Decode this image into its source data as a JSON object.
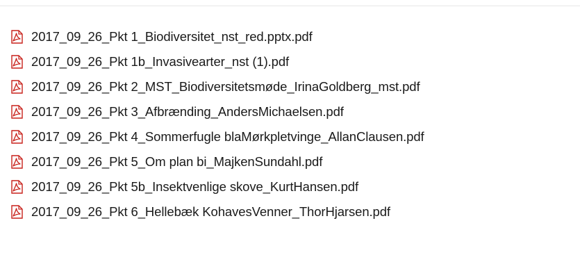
{
  "files": [
    {
      "name": "2017_09_26_Pkt 1_Biodiversitet_nst_red.pptx.pdf",
      "icon": "pdf-file-icon"
    },
    {
      "name": "2017_09_26_Pkt 1b_Invasivearter_nst (1).pdf",
      "icon": "pdf-file-icon"
    },
    {
      "name": "2017_09_26_Pkt 2_MST_Biodiversitetsmøde_IrinaGoldberg_mst.pdf",
      "icon": "pdf-file-icon"
    },
    {
      "name": "2017_09_26_Pkt 3_Afbrænding_AndersMichaelsen.pdf",
      "icon": "pdf-file-icon"
    },
    {
      "name": "2017_09_26_Pkt 4_Sommerfugle blaMørkpletvinge_AllanClausen.pdf",
      "icon": "pdf-file-icon"
    },
    {
      "name": "2017_09_26_Pkt 5_Om plan bi_MajkenSundahl.pdf",
      "icon": "pdf-file-icon"
    },
    {
      "name": "2017_09_26_Pkt 5b_Insektvenlige skove_KurtHansen.pdf",
      "icon": "pdf-file-icon"
    },
    {
      "name": "2017_09_26_Pkt 6_Hellebæk KohavesVenner_ThorHjarsen.pdf",
      "icon": "pdf-file-icon"
    }
  ],
  "colors": {
    "icon_red": "#c8211b",
    "icon_bg": "#ffffff",
    "text": "#1a1a1a"
  }
}
